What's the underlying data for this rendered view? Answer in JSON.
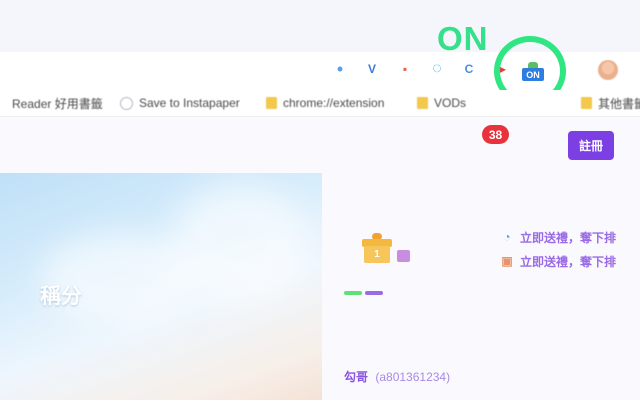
{
  "overlay": {
    "on_label": "ON"
  },
  "toolbar": {
    "extensions": [
      {
        "icon": "dots-icon",
        "glyph": "•",
        "color": "#5aa0e6"
      },
      {
        "icon": "v-logo-icon",
        "glyph": "V",
        "color": "#3a7bd5"
      },
      {
        "icon": "flag-icon",
        "glyph": "▪",
        "color": "#e8623a"
      },
      {
        "icon": "ring-icon",
        "glyph": "◌",
        "color": "#2bb0e3"
      },
      {
        "icon": "c-icon",
        "glyph": "C",
        "color": "#4a8fe0"
      },
      {
        "icon": "play-icon",
        "glyph": "▸",
        "color": "#e23d3d"
      }
    ],
    "on_extension_badge": "ON"
  },
  "bookmarks": [
    {
      "label": "Reader 好用書籤",
      "icon": "bookmark-icon"
    },
    {
      "label": "Save to Instapaper",
      "icon": "globe-icon"
    },
    {
      "label": "chrome://extension",
      "icon": "folder-icon"
    },
    {
      "label": "VODs",
      "icon": "folder-icon"
    },
    {
      "label": "其他書籤",
      "icon": "folder-icon"
    }
  ],
  "header": {
    "notification_count": "38",
    "register_label": "註冊"
  },
  "banner": {
    "title": "稱分"
  },
  "gift": {
    "count": "1"
  },
  "actions": [
    {
      "label": "立即送禮，奪下排",
      "icon": "clock-icon",
      "color": "#5aa0e6"
    },
    {
      "label": "立即送禮，奪下排",
      "icon": "gift-icon",
      "color": "#e8936a"
    }
  ],
  "user": {
    "nickname": "勾哥",
    "handle": "(a801361234)"
  },
  "colors": {
    "accent_purple": "#7b3fe4",
    "badge_red": "#e8323c",
    "on_green": "#35e08a",
    "action_text": "#9a6be6"
  }
}
